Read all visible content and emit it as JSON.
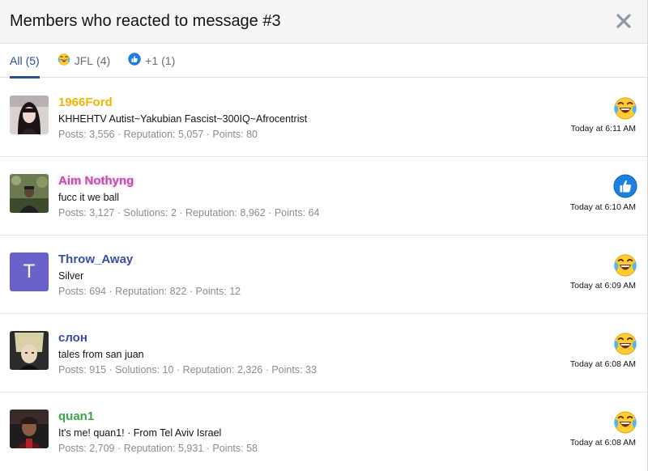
{
  "dialog": {
    "title": "Members who reacted to message #3",
    "close_icon": "close-icon"
  },
  "tabs": [
    {
      "label": "All",
      "count": "(5)",
      "icon": ""
    },
    {
      "label": "JFL",
      "count": "(4)",
      "icon": "laughing-crying-emoji-icon"
    },
    {
      "label": "+1",
      "count": "(1)",
      "icon": "thumbs-up-icon"
    }
  ],
  "members": [
    {
      "username": "1966Ford",
      "username_color": "#f3b400",
      "user_title": "KHHEHTV Autist~Yakubian Fascist~300IQ~Afrocentrist",
      "stats": "Posts: 3,556 · Reputation: 5,057 · Points: 80",
      "reaction": "laughing-crying-emoji-icon",
      "time": "Today at 6:11 AM"
    },
    {
      "username": "Aim Nothyng",
      "username_color": "#c05ab4",
      "user_title": "fucc it we ball",
      "stats": "Posts: 3,127 · Solutions: 2 · Reputation: 8,962 · Points: 64",
      "reaction": "thumbs-up-icon",
      "time": "Today at 6:10 AM"
    },
    {
      "username": "Throw_Away",
      "username_color": "#3a4ca5",
      "user_title": "Silver",
      "stats": "Posts: 694 · Reputation: 822 · Points: 12",
      "reaction": "laughing-crying-emoji-icon",
      "time": "Today at 6:09 AM",
      "avatar_letter": "T",
      "avatar_color": "#6b62c9"
    },
    {
      "username": "слон",
      "username_color": "#3a4ca5",
      "user_title": "tales from san juan",
      "stats": "Posts: 915 · Solutions: 10 · Reputation: 2,326 · Points: 33",
      "reaction": "laughing-crying-emoji-icon",
      "time": "Today at 6:08 AM"
    },
    {
      "username": "quan1",
      "username_color": "#3aa64a",
      "user_title": "It's me! quan1! · From Tel Aviv Israel",
      "stats": "Posts: 2,709 · Reputation: 5,931 · Points: 58",
      "reaction": "laughing-crying-emoji-icon",
      "time": "Today at 6:08 AM"
    }
  ]
}
